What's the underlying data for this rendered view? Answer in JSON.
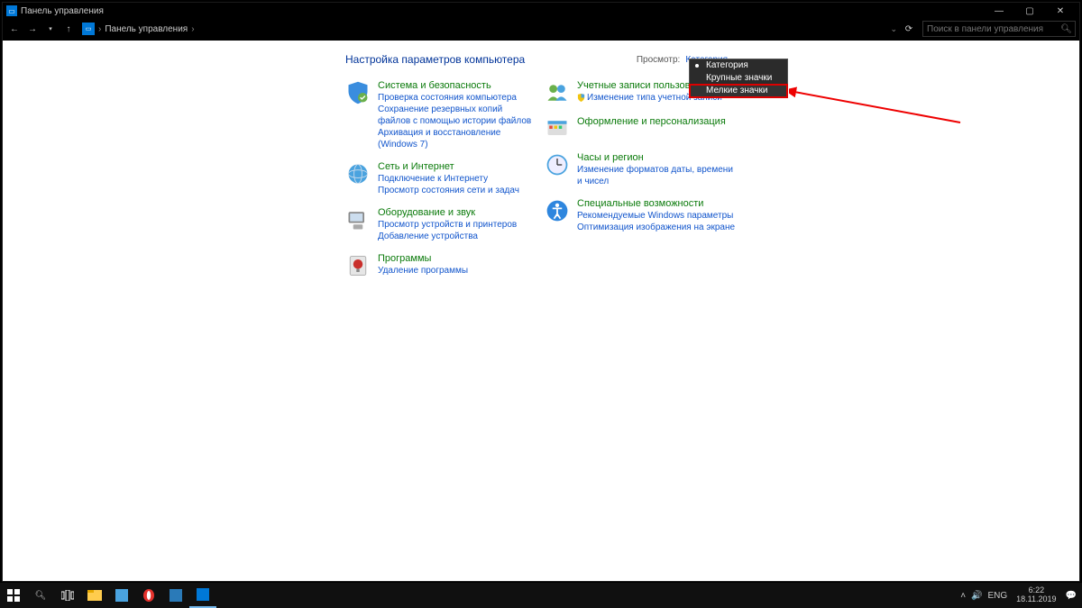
{
  "window": {
    "title": "Панель управления"
  },
  "breadcrumb": {
    "root": "Панель управления"
  },
  "search": {
    "placeholder": "Поиск в панели управления"
  },
  "heading": "Настройка параметров компьютера",
  "view": {
    "label": "Просмотр:",
    "value": "Категория"
  },
  "dropdown": {
    "options": [
      {
        "label": "Категория",
        "selected": true
      },
      {
        "label": "Крупные значки",
        "selected": false
      },
      {
        "label": "Мелкие значки",
        "selected": false,
        "highlight": true
      }
    ]
  },
  "left": [
    {
      "title": "Система и безопасность",
      "links": [
        "Проверка состояния компьютера",
        "Сохранение резервных копий файлов с помощью истории файлов",
        "Архивация и восстановление (Windows 7)"
      ]
    },
    {
      "title": "Сеть и Интернет",
      "links": [
        "Подключение к Интернету",
        "Просмотр состояния сети и задач"
      ]
    },
    {
      "title": "Оборудование и звук",
      "links": [
        "Просмотр устройств и принтеров",
        "Добавление устройства"
      ]
    },
    {
      "title": "Программы",
      "links": [
        "Удаление программы"
      ]
    }
  ],
  "right": [
    {
      "title": "Учетные записи пользователей",
      "links": [
        "Изменение типа учетной записи"
      ],
      "shield": true
    },
    {
      "title": "Оформление и персонализация",
      "links": []
    },
    {
      "title": "Часы и регион",
      "links": [
        "Изменение форматов даты, времени и чисел"
      ]
    },
    {
      "title": "Специальные возможности",
      "links": [
        "Рекомендуемые Windows параметры",
        "Оптимизация изображения на экране"
      ]
    }
  ],
  "tray": {
    "lang": "ENG",
    "time": "6:22",
    "date": "18.11.2019"
  }
}
